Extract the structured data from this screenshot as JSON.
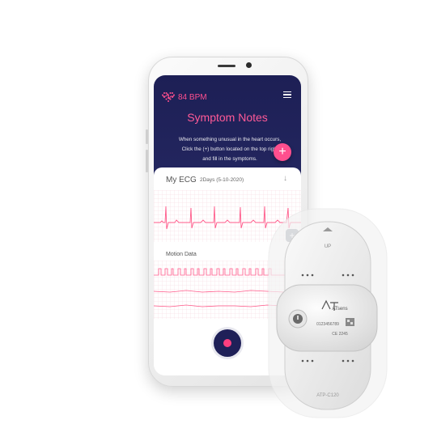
{
  "app": {
    "heart_rate": "84 BPM",
    "title": "Symptom Notes",
    "description_lines": [
      "When something unusual in the heart occurs,",
      "Click the (+) button located on the top right",
      "and fill in the symptoms."
    ],
    "add_label": "+",
    "ecg_title": "My ECG",
    "ecg_date": "2Days (5-10-2020)",
    "motion_title": "Motion Data",
    "zoom_label": "+",
    "icons": {
      "heart": "heart-icon",
      "menu": "menu-icon",
      "download": "arrow-down-icon",
      "zoom": "zoom-in-icon",
      "record": "record-icon"
    }
  },
  "device": {
    "up_label": "UP",
    "brand": "ATsens",
    "serial": "0123456789",
    "ce_mark": "CE 2245",
    "model": "ATP-C120"
  },
  "colors": {
    "header_bg": "#1d1f55",
    "accent_pink": "#ff4f8e",
    "ecg_line": "#ff5a8a",
    "grid": "#f4c9d6"
  }
}
